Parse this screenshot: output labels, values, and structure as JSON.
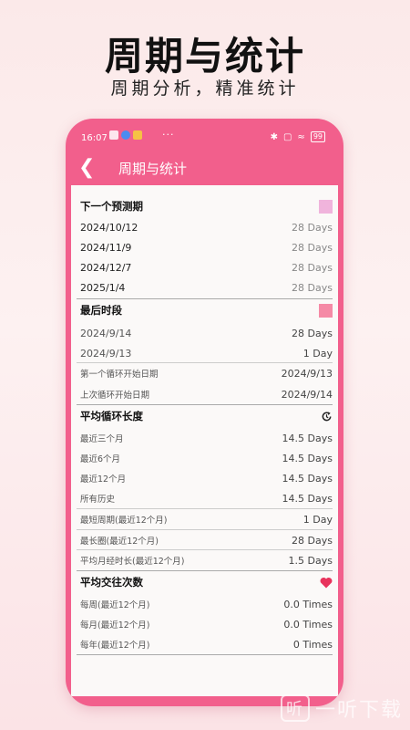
{
  "promo": {
    "title": "周期与统计",
    "subtitle": "周期分析，精准统计"
  },
  "status_bar": {
    "time": "16:07",
    "dots": "···",
    "battery": "99"
  },
  "app_bar": {
    "title": "周期与统计"
  },
  "sections": {
    "next_predicted": {
      "title": "下一个预测期",
      "swatch_color": "#f0b4dc",
      "rows": [
        {
          "date": "2024/10/12",
          "value": "28 Days"
        },
        {
          "date": "2024/11/9",
          "value": "28 Days"
        },
        {
          "date": "2024/12/7",
          "value": "28 Days"
        },
        {
          "date": "2025/1/4",
          "value": "28 Days"
        }
      ]
    },
    "last_period": {
      "title": "最后时段",
      "swatch_color": "#f58aa6",
      "rows": [
        {
          "date": "2024/9/14",
          "value": "28 Days"
        },
        {
          "date": "2024/9/13",
          "value": "1 Day"
        }
      ],
      "first_cycle_label": "第一个循环开始日期",
      "first_cycle_value": "2024/9/13",
      "last_cycle_label": "上次循环开始日期",
      "last_cycle_value": "2024/9/14"
    },
    "avg_cycle": {
      "title": "平均循环长度",
      "rows": [
        {
          "label": "最近三个月",
          "value": "14.5 Days"
        },
        {
          "label": "最近6个月",
          "value": "14.5 Days"
        },
        {
          "label": "最近12个月",
          "value": "14.5 Days"
        },
        {
          "label": "所有历史",
          "value": "14.5 Days"
        }
      ],
      "shortest_label": "最短周期(最近12个月)",
      "shortest_value": "1 Day",
      "longest_label": "最长圈(最近12个月)",
      "longest_value": "28 Days",
      "avg_period_label": "平均月经时长(最近12个月)",
      "avg_period_value": "1.5 Days"
    },
    "avg_intercourse": {
      "title": "平均交往次数",
      "heart_color": "#e8335c",
      "rows": [
        {
          "label": "每周(最近12个月)",
          "value": "0.0 Times"
        },
        {
          "label": "每月(最近12个月)",
          "value": "0.0 Times"
        },
        {
          "label": "每年(最近12个月)",
          "value": "0 Times"
        }
      ]
    }
  },
  "watermark": {
    "text": "一听下载",
    "logo": "听"
  },
  "colors": {
    "accent": "#f25f8c"
  }
}
